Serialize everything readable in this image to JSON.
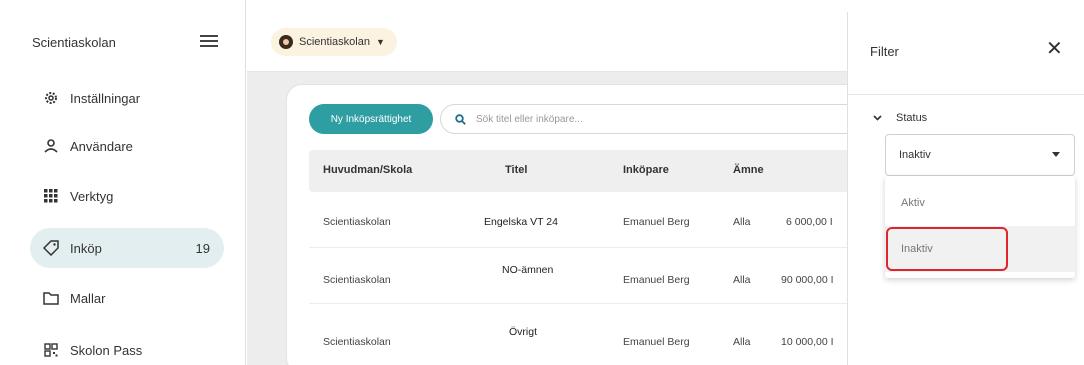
{
  "sidebar": {
    "org_name": "Scientiaskolan",
    "items": [
      {
        "label": "Inställningar",
        "icon": "gear-icon"
      },
      {
        "label": "Användare",
        "icon": "user-icon"
      },
      {
        "label": "Verktyg",
        "icon": "grid-icon"
      },
      {
        "label": "Inköp",
        "icon": "tag-icon",
        "badge": "19",
        "active": true
      },
      {
        "label": "Mallar",
        "icon": "folder-icon"
      },
      {
        "label": "Skolon Pass",
        "icon": "qr-icon"
      }
    ]
  },
  "topbar": {
    "org_chip": "Scientiaskolan"
  },
  "main": {
    "new_button": "Ny Inköpsrättighet",
    "search_placeholder": "Sök titel eller inköpare...",
    "columns": [
      "Huvudman/Skola",
      "Titel",
      "Inköpare",
      "Ämne"
    ],
    "rows": [
      {
        "org": "Scientiaskolan",
        "title": "Engelska VT 24",
        "buyer": "Emanuel Berg",
        "subject": "Alla",
        "amount": "6 000,00 I"
      },
      {
        "org": "Scientiaskolan",
        "title": "NO-ämnen",
        "buyer": "Emanuel Berg",
        "subject": "Alla",
        "amount": "90 000,00 I"
      },
      {
        "org": "Scientiaskolan",
        "title": "Övrigt",
        "buyer": "Emanuel Berg",
        "subject": "Alla",
        "amount": "10 000,00 I"
      }
    ]
  },
  "filter": {
    "title": "Filter",
    "section": "Status",
    "selected": "Inaktiv",
    "options": [
      "Aktiv",
      "Inaktiv"
    ]
  },
  "colors": {
    "accent": "#2f9ea2",
    "active_nav": "#e3eef0",
    "highlight": "#e0242b"
  }
}
